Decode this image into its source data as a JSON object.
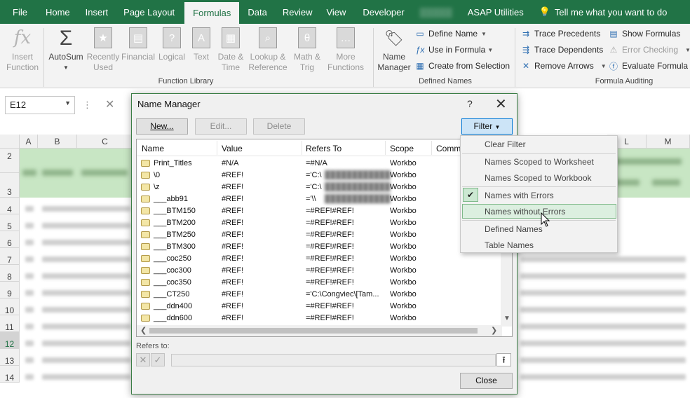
{
  "tabs": [
    "File",
    "Home",
    "Insert",
    "Page Layout",
    "Formulas",
    "Data",
    "Review",
    "View",
    "Developer",
    "▒▒▒▒▒",
    "ASAP Utilities"
  ],
  "active_tab": "Formulas",
  "tell_me": "Tell me what you want to do",
  "ribbon": {
    "insert_function": "Insert\nFunction",
    "autosum": "AutoSum",
    "recently_used": "Recently\nUsed",
    "financial": "Financial",
    "logical": "Logical",
    "text": "Text",
    "date_time": "Date &\nTime",
    "lookup_reference": "Lookup &\nReference",
    "math_trig": "Math &\nTrig",
    "more_functions": "More\nFunctions",
    "function_library_label": "Function Library",
    "name_manager": "Name\nManager",
    "define_name": "Define Name",
    "use_in_formula": "Use in Formula",
    "create_from_selection": "Create from Selection",
    "defined_names_label": "Defined Names",
    "trace_precedents": "Trace Precedents",
    "trace_dependents": "Trace Dependents",
    "remove_arrows": "Remove Arrows",
    "show_formulas": "Show Formulas",
    "error_checking": "Error Checking",
    "evaluate_formula": "Evaluate Formula",
    "formula_auditing_label": "Formula Auditing"
  },
  "formula_bar": {
    "name_box": "E12"
  },
  "grid": {
    "columns": [
      "A",
      "B",
      "C",
      "L",
      "M"
    ],
    "rows": [
      "2",
      "3",
      "4",
      "5",
      "6",
      "7",
      "8",
      "9",
      "10",
      "11",
      "12",
      "13",
      "14"
    ]
  },
  "dialog": {
    "title": "Name Manager",
    "help": "?",
    "new_button": "New...",
    "edit_button": "Edit...",
    "delete_button": "Delete",
    "filter_button": "Filter",
    "columns": [
      "Name",
      "Value",
      "Refers To",
      "Scope",
      "Comme"
    ],
    "rows": [
      {
        "name": "Print_Titles",
        "value": "#N/A",
        "refers": "=#N/A",
        "scope": "Workbo"
      },
      {
        "name": "\\0",
        "value": "#REF!",
        "refers": "='C:\\",
        "scope": "Workbo",
        "blur": true
      },
      {
        "name": "\\z",
        "value": "#REF!",
        "refers": "='C:\\",
        "scope": "Workbo",
        "blur": true
      },
      {
        "name": "___abb91",
        "value": "#REF!",
        "refers": "='\\\\",
        "scope": "Workbo",
        "blur": true
      },
      {
        "name": "___BTM150",
        "value": "#REF!",
        "refers": "=#REF!#REF!",
        "scope": "Workbo"
      },
      {
        "name": "___BTM200",
        "value": "#REF!",
        "refers": "=#REF!#REF!",
        "scope": "Workbo"
      },
      {
        "name": "___BTM250",
        "value": "#REF!",
        "refers": "=#REF!#REF!",
        "scope": "Workbo"
      },
      {
        "name": "___BTM300",
        "value": "#REF!",
        "refers": "=#REF!#REF!",
        "scope": "Workbo"
      },
      {
        "name": "___coc250",
        "value": "#REF!",
        "refers": "=#REF!#REF!",
        "scope": "Workbo"
      },
      {
        "name": "___coc300",
        "value": "#REF!",
        "refers": "=#REF!#REF!",
        "scope": "Workbo"
      },
      {
        "name": "___coc350",
        "value": "#REF!",
        "refers": "=#REF!#REF!",
        "scope": "Workbo"
      },
      {
        "name": "___CT250",
        "value": "#REF!",
        "refers": "='C:\\Congviec\\[Tam...",
        "scope": "Workbo"
      },
      {
        "name": "___ddn400",
        "value": "#REF!",
        "refers": "=#REF!#REF!",
        "scope": "Workbo"
      },
      {
        "name": "___ddn600",
        "value": "#REF!",
        "refers": "=#REF!#REF!",
        "scope": "Workbo"
      }
    ],
    "refers_to_label": "Refers to:",
    "close_button": "Close"
  },
  "filter_menu": {
    "clear": "Clear Filter",
    "scoped_worksheet": "Names Scoped to Worksheet",
    "scoped_workbook": "Names Scoped to Workbook",
    "with_errors": "Names with Errors",
    "without_errors": "Names without Errors",
    "defined": "Defined Names",
    "table": "Table Names"
  },
  "colors": {
    "excel_green": "#217346",
    "selection": "#dcefe0"
  }
}
